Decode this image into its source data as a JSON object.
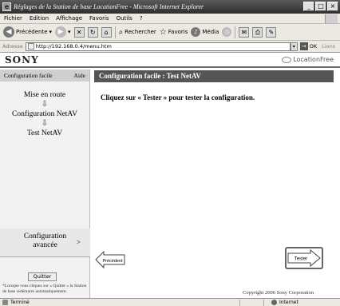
{
  "window": {
    "title": "Réglages de la Station de base LocationFree - Microsoft Internet Explorer",
    "controls": [
      "minimize",
      "maximize",
      "close"
    ]
  },
  "menubar": {
    "items": [
      "Fichier",
      "Edition",
      "Affichage",
      "Favoris",
      "Outils",
      "?"
    ]
  },
  "toolbar": {
    "back_label": "Précédente",
    "search_label": "Rechercher",
    "favorites_label": "Favoris",
    "media_label": "Média"
  },
  "addressbar": {
    "label": "Adresse",
    "url": "http://192.168.0.4/menu.htm",
    "go_label": "OK",
    "links_label": "Liens"
  },
  "page": {
    "brand": "SONY",
    "product_logo": "LocationFree",
    "sidebar": {
      "heading": "Configuration facile",
      "help": "Aide",
      "steps": [
        "Mise en route",
        "Configuration NetAV",
        "Test NetAV"
      ],
      "advanced_label": "Configuration avancée",
      "quit_label": "Quitter",
      "note": "*Lorsque vous cliquez sur « Quitter » la Station de base redémarre automatiquement."
    },
    "main": {
      "heading": "Configuration facile : Test NetAV",
      "instruction": "Cliquez sur « Tester » pour tester la configuration.",
      "prev_label": "Précédent",
      "test_label": "Tester",
      "copyright": "Copyright 2006 Sony Corporation"
    }
  },
  "statusbar": {
    "status": "Terminé",
    "zone": "Internet"
  }
}
